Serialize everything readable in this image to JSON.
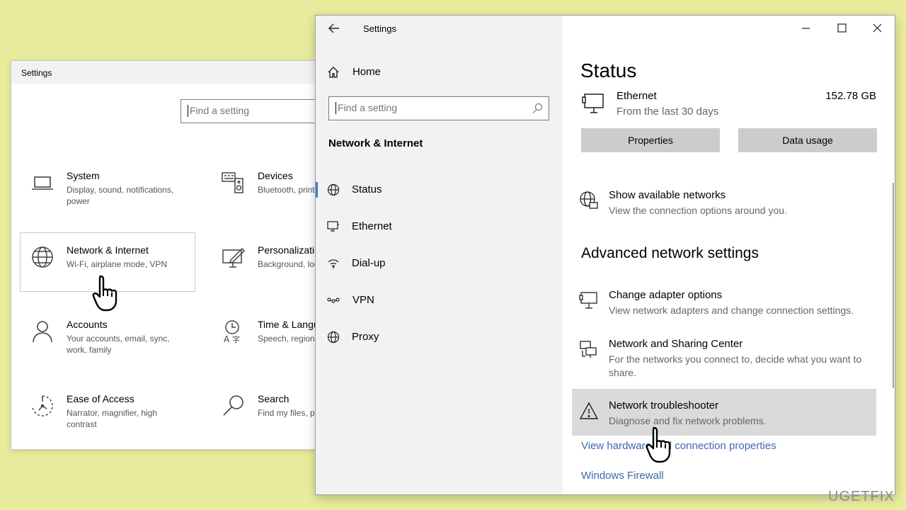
{
  "back_window": {
    "title": "Settings",
    "search_placeholder": "Find a setting",
    "categories": [
      {
        "name": "System",
        "desc": "Display, sound, notifications, power",
        "icon": "laptop-icon"
      },
      {
        "name": "Devices",
        "desc": "Bluetooth, printers, mouse",
        "icon": "devices-icon"
      },
      {
        "name": "Network & Internet",
        "desc": "Wi-Fi, airplane mode, VPN",
        "icon": "globe-icon"
      },
      {
        "name": "Personalization",
        "desc": "Background, lock screen, colors",
        "icon": "personalization-icon"
      },
      {
        "name": "Accounts",
        "desc": "Your accounts, email, sync, work, family",
        "icon": "person-icon"
      },
      {
        "name": "Time & Language",
        "desc": "Speech, region, date",
        "icon": "time-language-icon"
      },
      {
        "name": "Ease of Access",
        "desc": "Narrator, magnifier, high contrast",
        "icon": "ease-of-access-icon"
      },
      {
        "name": "Search",
        "desc": "Find my files, permissions",
        "icon": "search-icon"
      }
    ]
  },
  "front_window": {
    "title": "Settings",
    "nav": {
      "home_label": "Home",
      "search_placeholder": "Find a setting",
      "section_title": "Network & Internet",
      "items": [
        {
          "label": "Status",
          "icon": "globe-icon",
          "selected": true
        },
        {
          "label": "Ethernet",
          "icon": "ethernet-icon",
          "selected": false
        },
        {
          "label": "Dial-up",
          "icon": "dialup-icon",
          "selected": false
        },
        {
          "label": "VPN",
          "icon": "vpn-icon",
          "selected": false
        },
        {
          "label": "Proxy",
          "icon": "globe-icon",
          "selected": false
        }
      ]
    },
    "main": {
      "page_title": "Status",
      "ethernet": {
        "name": "Ethernet",
        "period": "From the last 30 days",
        "usage": "152.78 GB"
      },
      "properties_label": "Properties",
      "data_usage_label": "Data usage",
      "show_networks": {
        "title": "Show available networks",
        "desc": "View the connection options around you."
      },
      "advanced_heading": "Advanced network settings",
      "advanced_items": [
        {
          "title": "Change adapter options",
          "desc": "View network adapters and change connection settings.",
          "icon": "adapter-icon"
        },
        {
          "title": "Network and Sharing Center",
          "desc": "For the networks you connect to, decide what you want to share.",
          "icon": "sharing-center-icon"
        },
        {
          "title": "Network troubleshooter",
          "desc": "Diagnose and fix network problems.",
          "icon": "warning-icon",
          "highlighted": true
        }
      ],
      "links": [
        "View hardware and connection properties",
        "Windows Firewall"
      ]
    }
  },
  "watermark": "UGETFIX",
  "colors": {
    "background": "#e8ec9c",
    "nav_bg": "#f2f2f2",
    "accent": "#3a7bd5",
    "link": "#3c69b0",
    "button_bg": "#cccccc",
    "highlight": "#dadada"
  }
}
